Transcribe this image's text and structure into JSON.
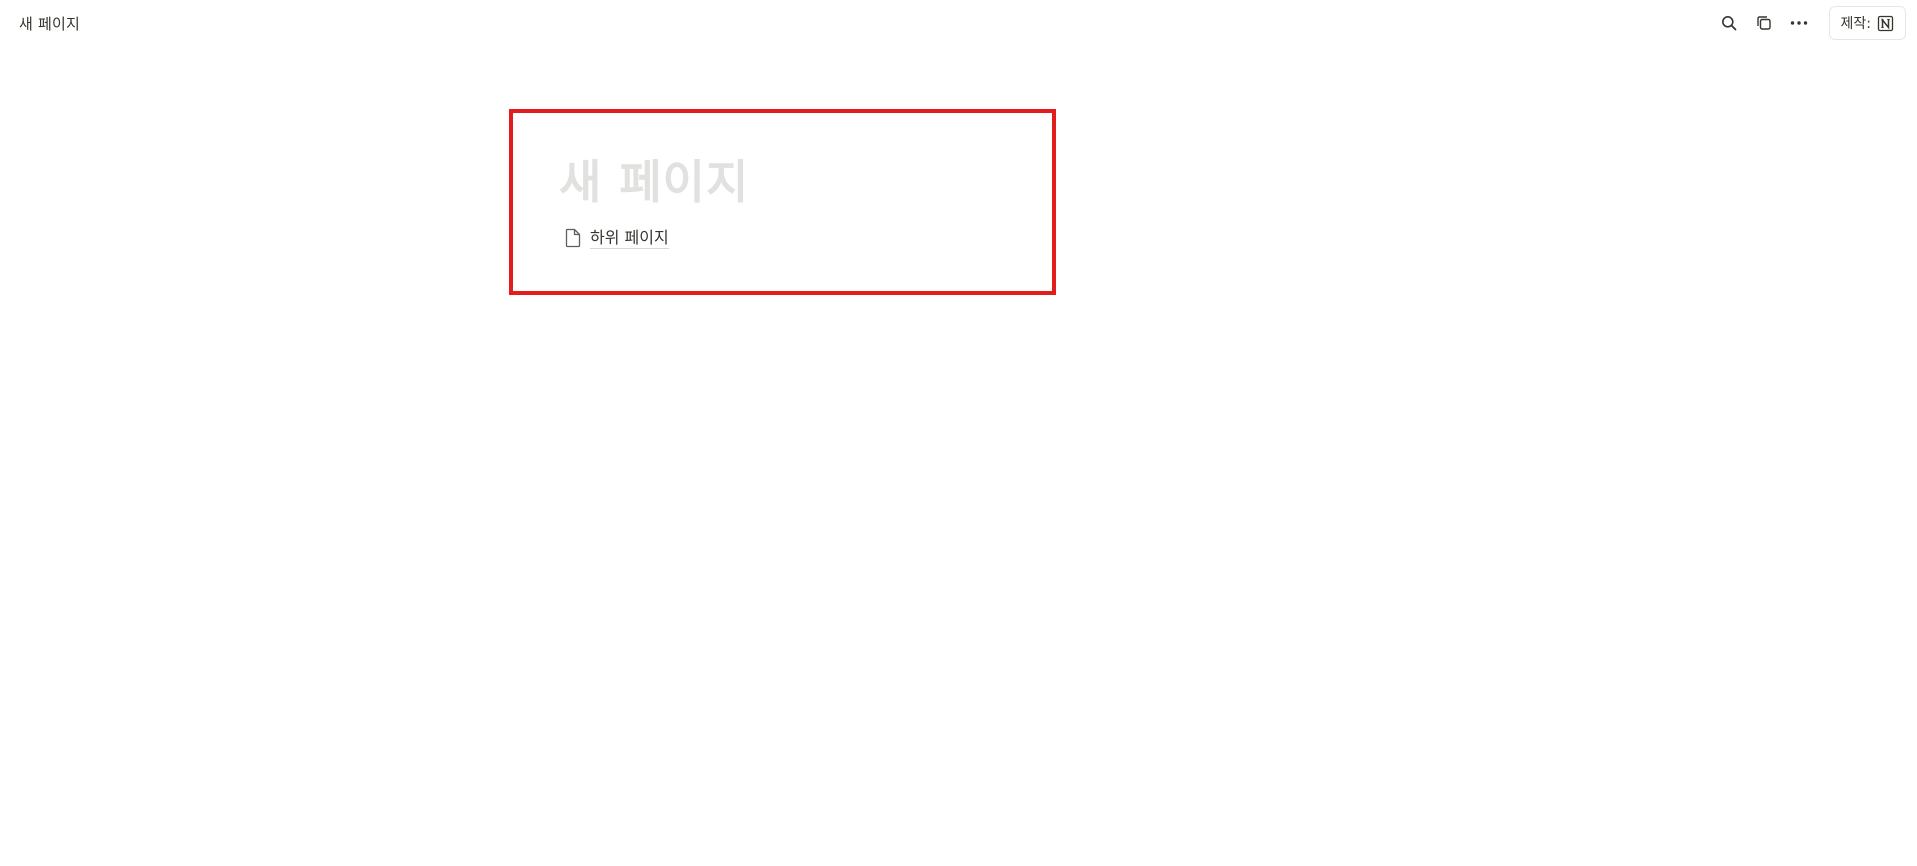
{
  "topbar": {
    "breadcrumb": "새 페이지",
    "actions": {
      "search_icon": "search-icon",
      "duplicate_icon": "duplicate-icon",
      "more_icon": "more-icon",
      "made_with_label": "제작:",
      "made_with_logo": "notion-logo"
    }
  },
  "page": {
    "title": "새 페이지",
    "subpages": [
      {
        "icon": "page-icon",
        "label": "하위 페이지"
      }
    ]
  },
  "colors": {
    "highlight_border": "#e31c1c",
    "title_placeholder": "#e1e1e0",
    "text": "#37352f"
  }
}
